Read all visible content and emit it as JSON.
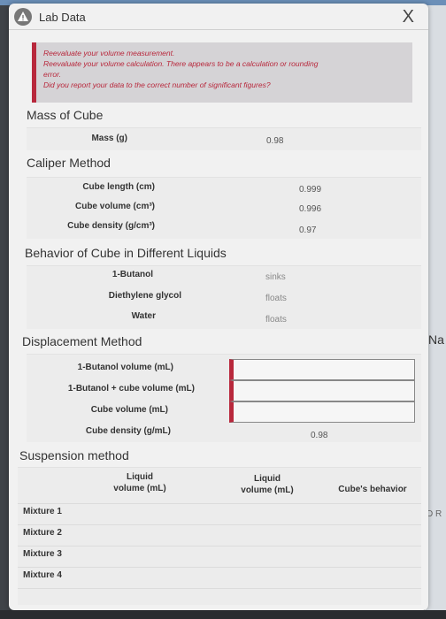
{
  "app": {
    "title": "Lab Data",
    "close_glyph": "X",
    "logo_icon": "warning-triangle-icon"
  },
  "feedback": {
    "line1": "Reevaluate your volume measurement.",
    "line2": "Reevaluate your volume calculation. There appears to be a calculation or rounding",
    "line3": "error.",
    "line4": "Did you report your data to the correct number of significant figures?"
  },
  "mass": {
    "title": "Mass of Cube",
    "label": "Mass (g)",
    "value": "0.98"
  },
  "caliper": {
    "title": "Caliper Method",
    "rows": [
      {
        "label": "Cube length (cm)",
        "value": "0.999"
      },
      {
        "label": "Cube volume (cm³)",
        "value": "0.996"
      },
      {
        "label": "Cube density (g/cm³)",
        "value": "0.97"
      }
    ]
  },
  "behavior": {
    "title": "Behavior of Cube in Different Liquids",
    "rows": [
      {
        "label": "1-Butanol",
        "value": "sinks"
      },
      {
        "label": "Diethylene glycol",
        "value": "floats"
      },
      {
        "label": "Water",
        "value": "floats"
      }
    ]
  },
  "displacement": {
    "title": "Displacement Method",
    "rows": [
      {
        "label": "1-Butanol volume (mL)",
        "value": ""
      },
      {
        "label": "1-Butanol + cube volume (mL)",
        "value": ""
      },
      {
        "label": "Cube volume (mL)",
        "value": ""
      },
      {
        "label": "Cube density (g/mL)",
        "value": "0.98"
      }
    ]
  },
  "suspension": {
    "title": "Suspension method",
    "headers": [
      "Liquid volume (mL)",
      "Liquid volume (mL)",
      "Cube's behavior"
    ],
    "header_lines": [
      [
        "Liquid",
        "volume (mL)"
      ],
      [
        "Liquid",
        "volume (mL)"
      ]
    ],
    "rows": [
      "Mixture 1",
      "Mixture 2",
      "Mixture 3",
      "Mixture 4"
    ]
  },
  "background": {
    "fragment1": "Na",
    "fragment2": "D R"
  },
  "colors": {
    "error_accent": "#b8283c",
    "panel": "#f1f1f1"
  }
}
